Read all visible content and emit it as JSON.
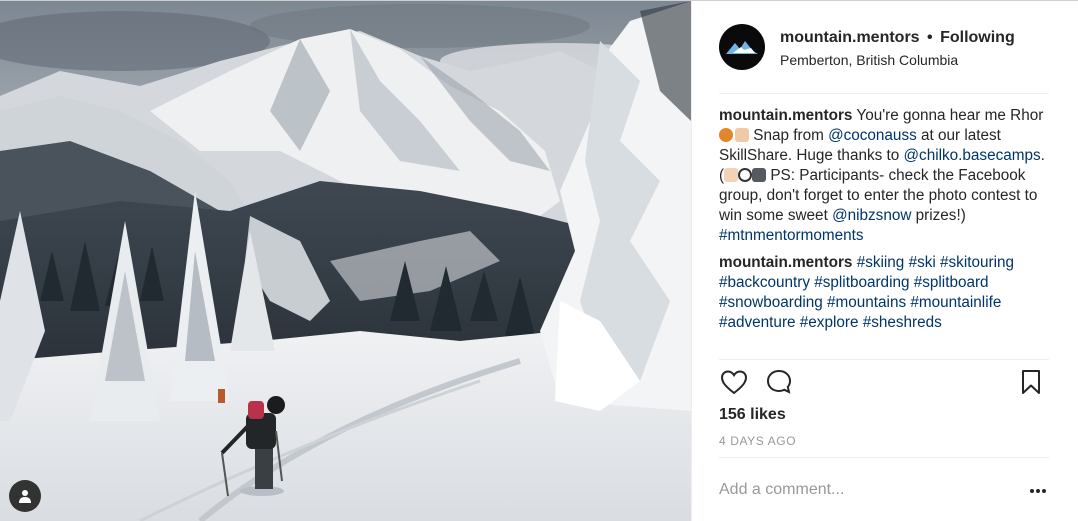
{
  "post": {
    "image_alt": "Skier skinning uphill on a snowy slope facing a mountain range",
    "header": {
      "username": "mountain.mentors",
      "separator": "•",
      "follow_status": "Following",
      "location": "Pemberton, British Columbia"
    },
    "caption": {
      "username": "mountain.mentors",
      "text_1": " You're gonna hear me Rhor",
      "text_2": " Snap from ",
      "mention_1": "@coconauss",
      "text_3": " at our latest SkillShare. Huge thanks to ",
      "mention_2": "@chilko.basecamps",
      "text_4": ". (",
      "text_5": " PS: Participants- check the Facebook group, don't forget to enter the photo contest to win some sweet ",
      "mention_3": "@nibzsnow",
      "text_6": " prizes!) ",
      "hashtag": "#mtnmentormoments"
    },
    "comment": {
      "username": "mountain.mentors",
      "hashtags": [
        "#skiing",
        "#ski",
        "#skitouring",
        "#backcountry",
        "#splitboarding",
        "#splitboard",
        "#snowboarding",
        "#mountains",
        "#mountainlife",
        "#adventure",
        "#explore",
        "#sheshreds"
      ]
    },
    "actions": {
      "like_icon": "heart-icon",
      "comment_icon": "comment-bubble-icon",
      "save_icon": "bookmark-icon"
    },
    "likes": "156 likes",
    "age": "4 DAYS AGO",
    "add_comment_placeholder": "Add a comment...",
    "more_icon": "more-options-icon"
  },
  "colors": {
    "link": "#003569",
    "text": "#262626",
    "muted": "#999999",
    "divider": "#efefef"
  }
}
